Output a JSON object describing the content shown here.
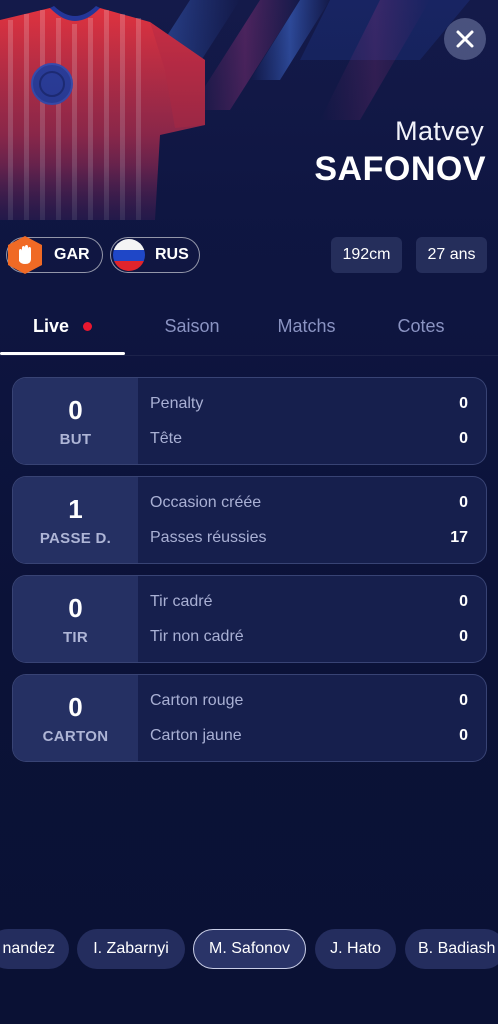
{
  "player": {
    "first_name": "Matvey",
    "last_name": "SAFONOV"
  },
  "tags": {
    "position": {
      "label": "GAR",
      "icon": "goalkeeper-glove-icon",
      "color": "#f06a25"
    },
    "nation": {
      "label": "RUS",
      "icon": "russia-flag-icon"
    },
    "height": "192cm",
    "age": "27 ans"
  },
  "tabs": [
    {
      "label": "Live",
      "active": true,
      "live_indicator": true
    },
    {
      "label": "Saison"
    },
    {
      "label": "Matchs"
    },
    {
      "label": "Cotes"
    }
  ],
  "stats": [
    {
      "value": "0",
      "label": "BUT",
      "rows": [
        {
          "name": "Penalty",
          "value": "0"
        },
        {
          "name": "Tête",
          "value": "0"
        }
      ]
    },
    {
      "value": "1",
      "label": "PASSE D.",
      "rows": [
        {
          "name": "Occasion créée",
          "value": "0"
        },
        {
          "name": "Passes réussies",
          "value": "17"
        }
      ]
    },
    {
      "value": "0",
      "label": "TIR",
      "rows": [
        {
          "name": "Tir cadré",
          "value": "0"
        },
        {
          "name": "Tir non cadré",
          "value": "0"
        }
      ]
    },
    {
      "value": "0",
      "label": "CARTON",
      "rows": [
        {
          "name": "Carton rouge",
          "value": "0"
        },
        {
          "name": "Carton jaune",
          "value": "0"
        }
      ]
    }
  ],
  "players_carousel": [
    {
      "label": "nandez"
    },
    {
      "label": "I. Zabarnyi"
    },
    {
      "label": "M. Safonov",
      "selected": true
    },
    {
      "label": "J. Hato"
    },
    {
      "label": "B. Badiash"
    }
  ],
  "colors": {
    "background": "#0b1238",
    "card": "#161f4d",
    "card_left": "#253063",
    "live_dot": "#e8172f",
    "jersey": "#d62d3f"
  }
}
